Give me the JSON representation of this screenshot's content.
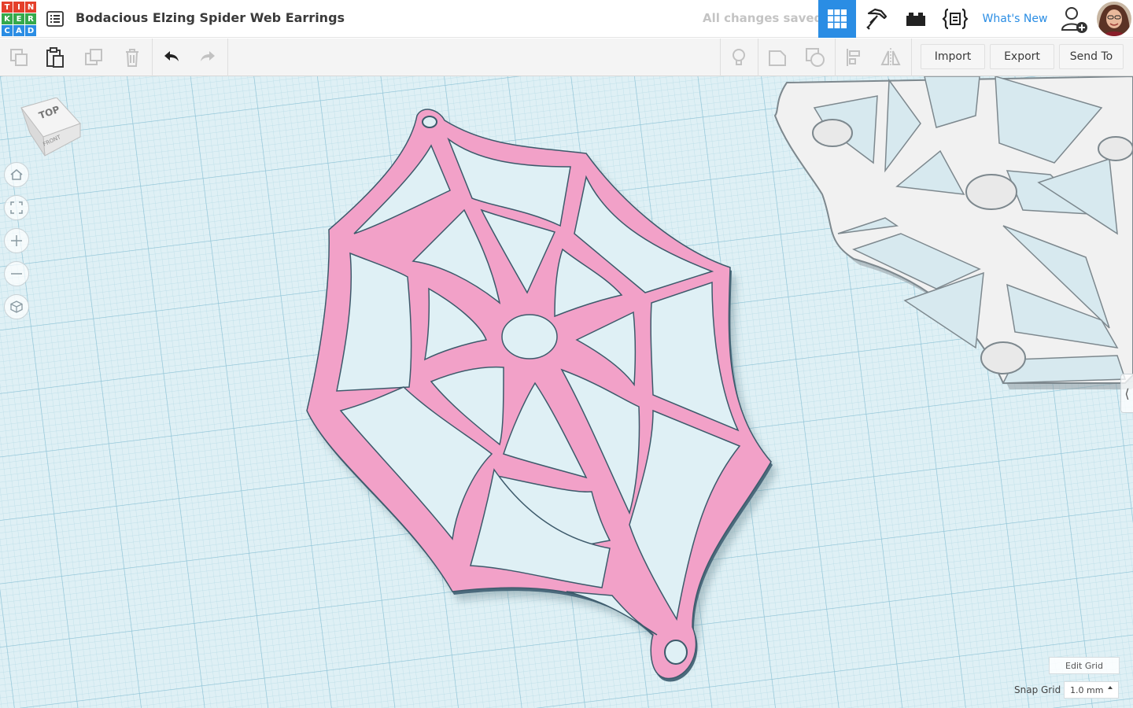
{
  "app": {
    "logo_letters": [
      "T",
      "I",
      "N",
      "K",
      "E",
      "R",
      "C",
      "A",
      "D"
    ],
    "logo_colors": [
      "#e4402b",
      "#e4402b",
      "#e4402b",
      "#35a94b",
      "#35a94b",
      "#35a94b",
      "#2a8de4",
      "#2a8de4",
      "#2a8de4"
    ],
    "design_title": "Bodacious Elzing Spider Web Earrings",
    "save_status": "All changes saved",
    "whats_new_label": "What's New",
    "accent_color": "#2a8de4"
  },
  "header_buttons": [
    {
      "icon": "grid-view-icon",
      "active": true
    },
    {
      "icon": "pickaxe-icon",
      "active": false
    },
    {
      "icon": "bricks-icon",
      "active": false
    },
    {
      "icon": "codeblocks-icon",
      "active": false
    }
  ],
  "toolbar": {
    "import_label": "Import",
    "export_label": "Export",
    "send_to_label": "Send To",
    "edit_tools": [
      "copy-icon",
      "paste-icon",
      "duplicate-icon",
      "delete-icon",
      "undo-icon",
      "redo-icon"
    ],
    "shape_tools": [
      "note-icon",
      "notes-toggle-icon",
      "show-all-icon",
      "align-icon",
      "mirror-icon"
    ]
  },
  "viewcube": {
    "top_label": "TOP",
    "front_label": "FRONT"
  },
  "nav_controls": [
    "home-view-icon",
    "fit-view-icon",
    "zoom-in-icon",
    "zoom-out-icon",
    "perspective-icon"
  ],
  "workplane": {
    "edit_grid_label": "Edit Grid",
    "snap_grid_label": "Snap Grid",
    "snap_grid_value": "1.0 mm",
    "grid_color": "#dff0f5"
  },
  "objects": [
    {
      "name": "Spider web earring (selected)",
      "color": "#f2a1c8"
    },
    {
      "name": "Spider web earring",
      "color": "#f1f1f1"
    }
  ]
}
